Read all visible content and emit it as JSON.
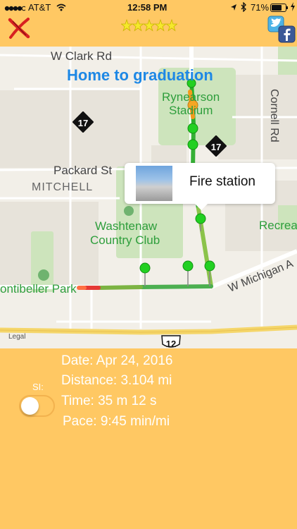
{
  "status_bar": {
    "carrier": "AT&T",
    "time": "12:58 PM",
    "battery": "71%"
  },
  "header": {
    "stars_count": 5,
    "close_icon": "close-x-icon",
    "social_icons": [
      "twitter-icon",
      "facebook-icon"
    ]
  },
  "map": {
    "route_title": "Home to graduation",
    "callout": {
      "label": "Fire station"
    },
    "labels": {
      "w_clark_rd": "W Clark Rd",
      "rynearson": "Rynearson",
      "stadium": "Stadium",
      "cornell_rd": "Cornell Rd",
      "packard_st": "Packard St",
      "mitchell": "MITCHELL",
      "washtenaw": "Washtenaw",
      "country_club": "Country Club",
      "recrea": "Recrea",
      "w_michigan": "W Michigan A",
      "montibeller": "ontibeller Park",
      "legal": "Legal",
      "shield_17": "17",
      "shield_12": "12"
    }
  },
  "stats": {
    "date": "Date: Apr 24, 2016",
    "distance": "Distance: 3.104 mi",
    "time": "Time: 35 m 12 s",
    "pace": "Pace: 9:45 min/mi",
    "si_label": "SI:",
    "si_toggle_on": false
  },
  "colors": {
    "background": "#FFC863",
    "route_title": "#1E88E5",
    "park_label": "#2E9E3C",
    "pin": "#22D022"
  }
}
